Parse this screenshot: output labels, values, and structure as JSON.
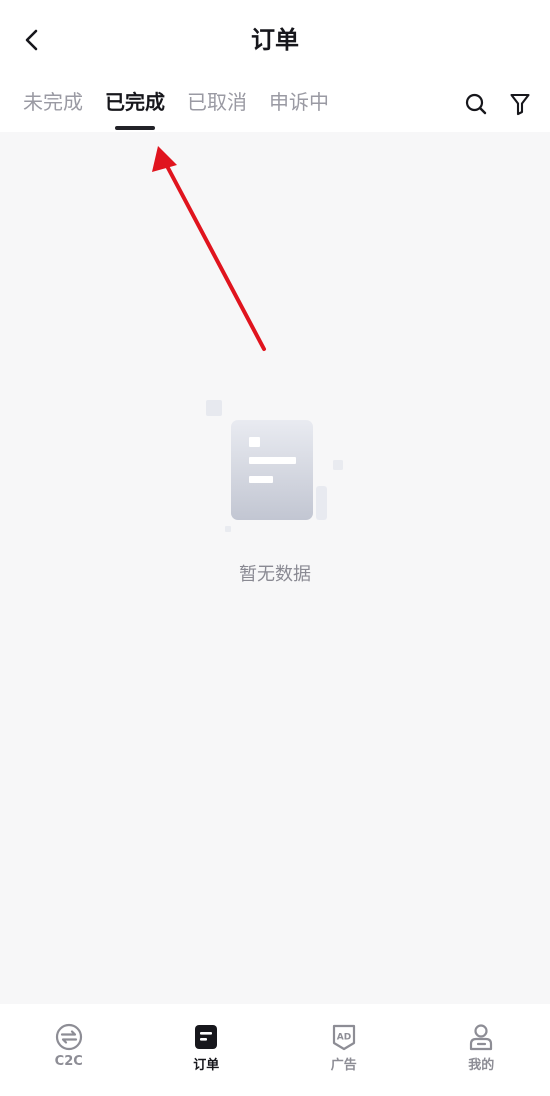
{
  "header": {
    "title": "订单",
    "back_icon": "chevron-left-icon"
  },
  "tabs": [
    {
      "label": "未完成",
      "active": false
    },
    {
      "label": "已完成",
      "active": true
    },
    {
      "label": "已取消",
      "active": false
    },
    {
      "label": "申诉中",
      "active": false
    }
  ],
  "toolbar": {
    "search_icon": "search-icon",
    "filter_icon": "filter-icon"
  },
  "empty_state": {
    "icon": "empty-document-icon",
    "text": "暂无数据"
  },
  "bottom_nav": [
    {
      "label": "C2C",
      "icon": "exchange-icon",
      "active": false
    },
    {
      "label": "订单",
      "icon": "order-icon",
      "active": true
    },
    {
      "label": "广告",
      "icon": "ad-icon",
      "active": false
    },
    {
      "label": "我的",
      "icon": "profile-icon",
      "active": false
    }
  ],
  "colors": {
    "active_text": "#17171c",
    "inactive_text": "#9a9aa3",
    "background": "#f7f7f8",
    "annotation_arrow": "#e0141e"
  }
}
